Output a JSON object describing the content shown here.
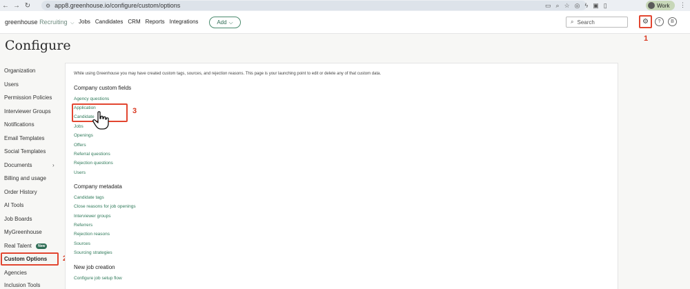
{
  "browser": {
    "url": "app8.greenhouse.io/configure/custom/options",
    "profile_label": "Work"
  },
  "header": {
    "logo_main": "greenhouse",
    "logo_sub": "Recruiting",
    "nav": [
      "Jobs",
      "Candidates",
      "CRM",
      "Reports",
      "Integrations"
    ],
    "add_label": "Add",
    "search_placeholder": "Search"
  },
  "callouts": {
    "one": "1",
    "two": "2",
    "three": "3"
  },
  "page_title": "Configure",
  "sidebar": {
    "items": [
      "Organization",
      "Users",
      "Permission Policies",
      "Interviewer Groups",
      "Notifications",
      "Email Templates",
      "Social Templates",
      "Documents",
      "Billing and usage",
      "Order History",
      "AI Tools",
      "Job Boards",
      "MyGreenhouse",
      "Real Talent",
      "Custom Options",
      "Agencies",
      "Inclusion Tools"
    ],
    "new_badge": "New",
    "active": "Custom Options"
  },
  "content": {
    "intro": "While using Greenhouse you may have created custom tags, sources, and rejection reasons. This page is your launching point to edit or delete any of that custom data.",
    "sections": [
      {
        "heading": "Company custom fields",
        "links": [
          "Agency questions",
          "Application",
          "Candidate",
          "Jobs",
          "Openings",
          "Offers",
          "Referral questions",
          "Rejection questions",
          "Users"
        ]
      },
      {
        "heading": "Company metadata",
        "links": [
          "Candidate tags",
          "Close reasons for job openings",
          "Interviewer groups",
          "Referrers",
          "Rejection reasons",
          "Sources",
          "Sourcing strategies"
        ]
      },
      {
        "heading": "New job creation",
        "links": [
          "Configure job setup flow"
        ]
      }
    ]
  },
  "colors": {
    "accent": "#2f7a5a",
    "highlight": "#e2452f"
  }
}
